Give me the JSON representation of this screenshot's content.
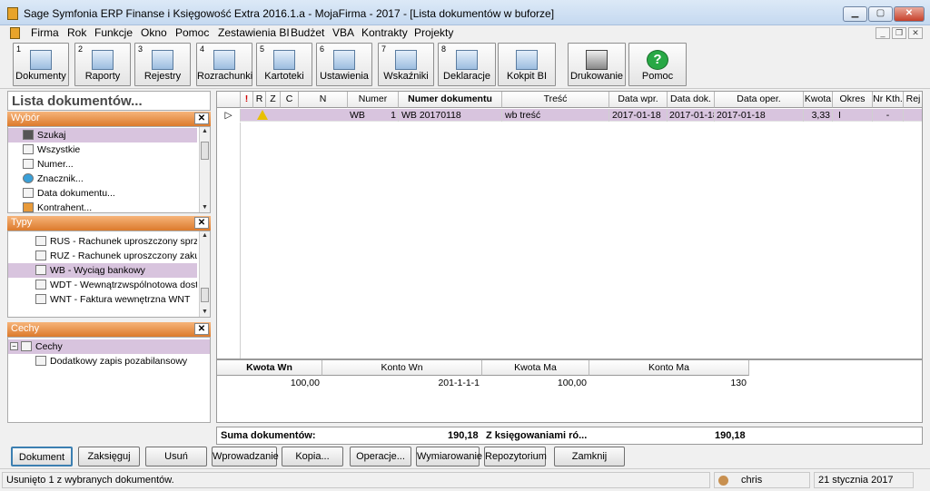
{
  "window": {
    "title": "Sage Symfonia ERP Finanse i Księgowość Extra 2016.1.a - MojaFirma - 2017 - [Lista dokumentów w buforze]"
  },
  "menu": [
    "Firma",
    "Rok",
    "Funkcje",
    "Okno",
    "Pomoc",
    "Zestawienia BI",
    "Budżet",
    "VBA",
    "Kontrakty",
    "Projekty"
  ],
  "toolbar": [
    {
      "num": "1",
      "label": "Dokumenty"
    },
    {
      "num": "2",
      "label": "Raporty"
    },
    {
      "num": "3",
      "label": "Rejestry"
    },
    {
      "num": "4",
      "label": "Rozrachunki"
    },
    {
      "num": "5",
      "label": "Kartoteki"
    },
    {
      "num": "6",
      "label": "Ustawienia"
    },
    {
      "num": "7",
      "label": "Wskaźniki"
    },
    {
      "num": "8",
      "label": "Deklaracje"
    },
    {
      "num": "",
      "label": "Kokpit BI"
    },
    {
      "num": "",
      "label": "Drukowanie"
    },
    {
      "num": "",
      "label": "Pomoc"
    }
  ],
  "left": {
    "title": "Lista dokumentów...",
    "wybor": {
      "title": "Wybór",
      "items": [
        "Szukaj",
        "Wszystkie",
        "Numer...",
        "Znacznik...",
        "Data dokumentu...",
        "Kontrahent..."
      ]
    },
    "typy": {
      "title": "Typy",
      "items": [
        "RUS - Rachunek uproszczony sprz...",
        "RUZ - Rachunek uproszczony zakup",
        "WB - Wyciąg bankowy",
        "WDT - Wewnątrzwspólnotowa dost...",
        "WNT - Faktura wewnętrzna WNT"
      ]
    },
    "cechy": {
      "title": "Cechy",
      "root": "Cechy",
      "child": "Dodatkowy zapis pozabilansowy"
    }
  },
  "grid": {
    "headers": [
      "",
      "!",
      "R",
      "Z",
      "C",
      "N",
      "Numer",
      "Numer dokumentu",
      "Treść",
      "Data wpr.",
      "Data dok.",
      "Data oper.",
      "Kwota",
      "Okres",
      "Nr Kth.",
      "Rej"
    ],
    "row": {
      "numer_a": "WB",
      "numer_b": "1",
      "numer_dok": "WB 20170118",
      "tresc": "wb treść",
      "data_wpr": "2017-01-18",
      "data_dok": "2017-01-18",
      "data_oper": "2017-01-18",
      "kwota": "3,33",
      "okres": "I",
      "nr_kth": "-"
    }
  },
  "sub": {
    "headers": [
      "Kwota Wn",
      "Konto Wn",
      "Kwota Ma",
      "Konto Ma"
    ],
    "row": [
      "100,00",
      "201-1-1-1",
      "100,00",
      "130"
    ]
  },
  "summary": {
    "label1": "Suma dokumentów:",
    "value1": "190,18",
    "label2": "Z księgowaniami ró...",
    "value2": "190,18"
  },
  "buttons": [
    "Dokument",
    "Zaksięguj",
    "Usuń",
    "Wprowadzanie",
    "Kopia...",
    "Operacje...",
    "Wymiarowanie",
    "Repozytorium",
    "Zamknij"
  ],
  "status": {
    "message": "Usunięto 1 z wybranych dokumentów.",
    "user": "chris",
    "date": "21 stycznia 2017"
  }
}
